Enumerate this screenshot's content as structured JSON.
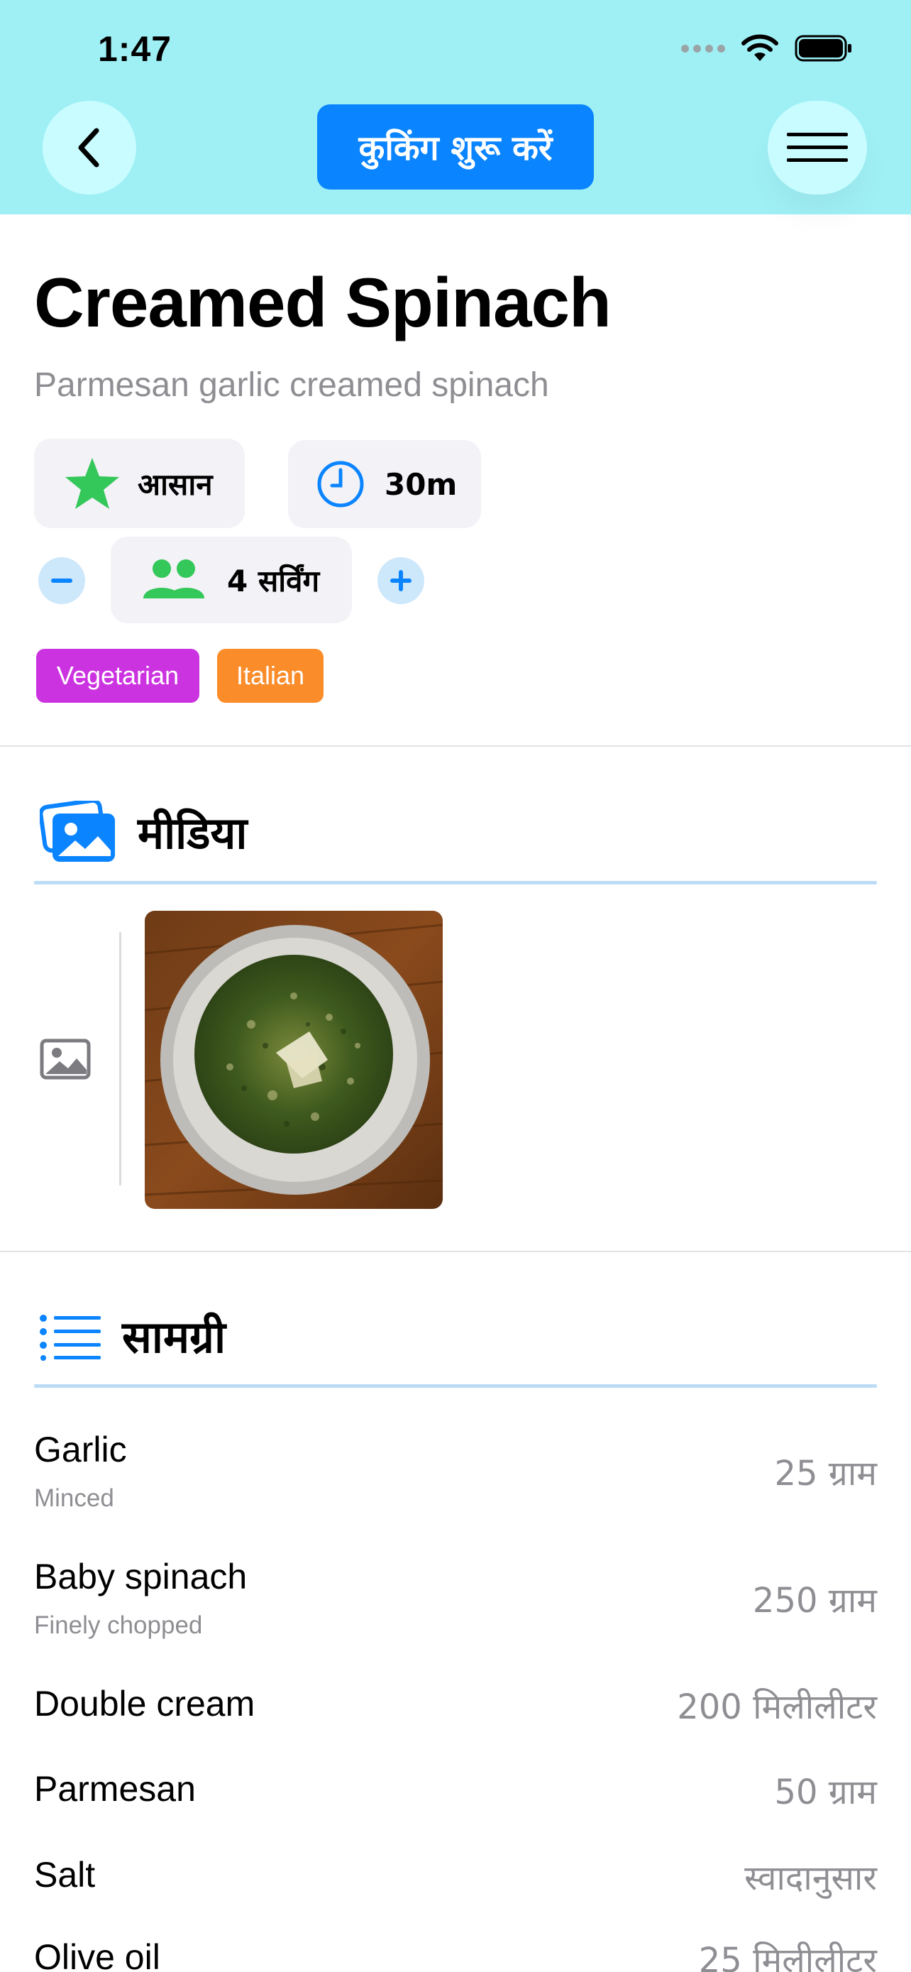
{
  "status": {
    "time": "1:47"
  },
  "header": {
    "start_cooking": "कुकिंग शुरू करें"
  },
  "recipe": {
    "title": "Creamed Spinach",
    "subtitle": "Parmesan garlic creamed spinach",
    "difficulty": "आसान",
    "time": "30m",
    "servings": "4 सर्विंग",
    "tags": [
      {
        "label": "Vegetarian",
        "color": "#cc33e0"
      },
      {
        "label": "Italian",
        "color": "#fa8c2a"
      }
    ]
  },
  "media": {
    "title": "मीडिया"
  },
  "ingredients": {
    "title": "सामग्री",
    "items": [
      {
        "name": "Garlic",
        "note": "Minced",
        "qty": "25 ग्राम"
      },
      {
        "name": "Baby spinach",
        "note": "Finely chopped",
        "qty": "250 ग्राम"
      },
      {
        "name": "Double cream",
        "note": "",
        "qty": "200 मिलीलीटर"
      },
      {
        "name": "Parmesan",
        "note": "",
        "qty": "50 ग्राम"
      },
      {
        "name": "Salt",
        "note": "",
        "qty": "स्वादानुसार"
      },
      {
        "name": "Olive oil",
        "note": "",
        "qty": "25 मिलीलीटर"
      }
    ]
  },
  "colors": {
    "accent": "#0a84ff",
    "header_bg": "#9ff0f5",
    "star": "#34c759",
    "people": "#34c759"
  }
}
